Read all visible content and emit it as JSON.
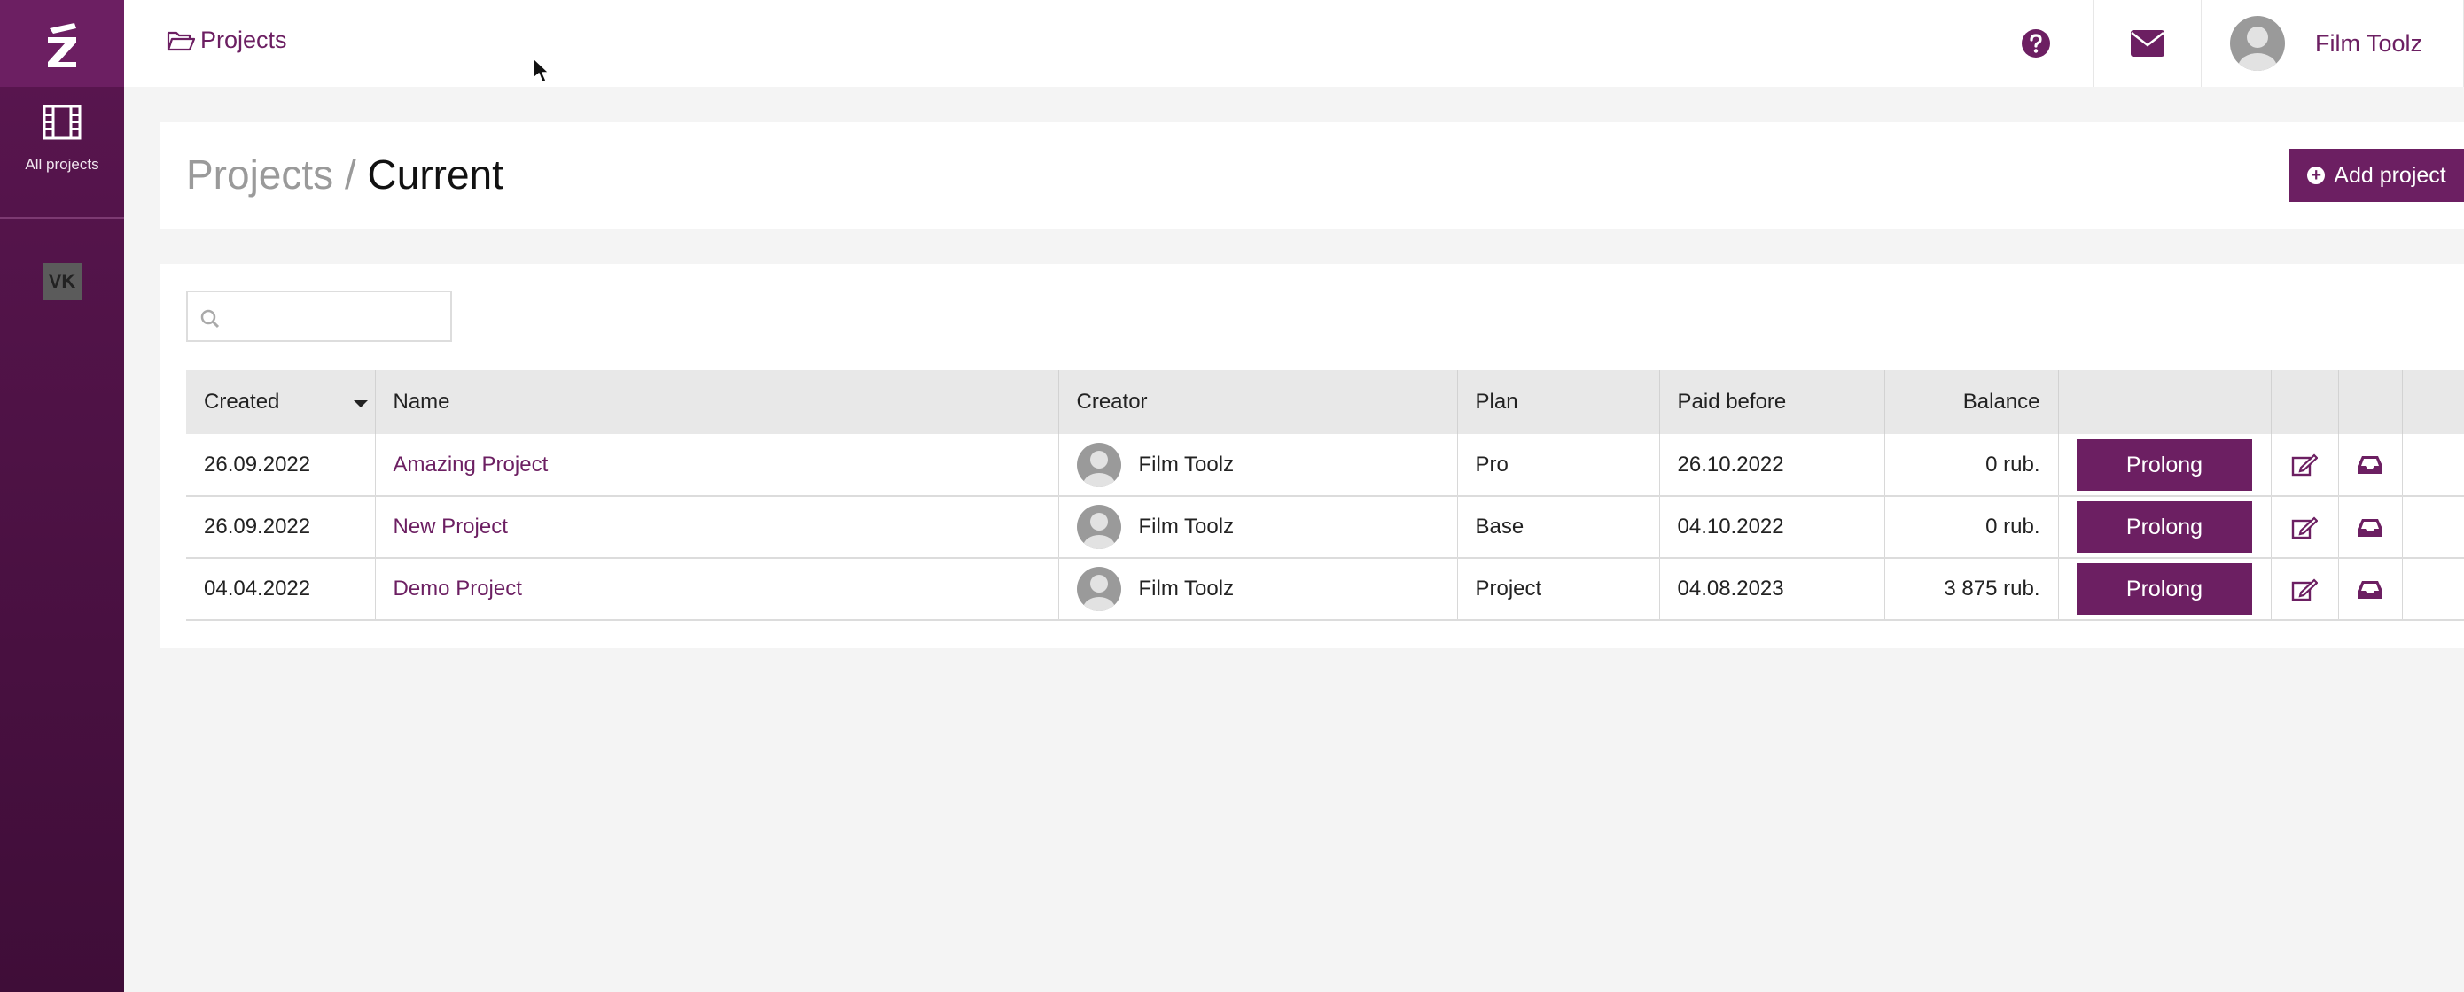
{
  "sidebar": {
    "logo_icon": "film-toolz-z-logo",
    "items": [
      {
        "label": "All projects",
        "icon": "film-icon"
      }
    ],
    "social_icon": "vk-icon",
    "social_label": "VK"
  },
  "topbar": {
    "breadcrumb": "Projects",
    "breadcrumb_icon": "folder-open-icon",
    "help_icon": "question-circle-icon",
    "mail_icon": "envelope-icon",
    "user_name": "Film Toolz"
  },
  "page": {
    "title_parent": "Projects /",
    "title_current": "Current",
    "add_button": "Add project"
  },
  "search": {
    "placeholder": ""
  },
  "table": {
    "headers": [
      "Created",
      "Name",
      "Creator",
      "Plan",
      "Paid before",
      "Balance",
      "",
      "",
      ""
    ],
    "rows": [
      {
        "created": "26.09.2022",
        "name": "Amazing Project",
        "creator": "Film Toolz",
        "plan": "Pro",
        "paid_before": "26.10.2022",
        "balance": "0 rub.",
        "action": "Prolong"
      },
      {
        "created": "26.09.2022",
        "name": "New Project",
        "creator": "Film Toolz",
        "plan": "Base",
        "paid_before": "04.10.2022",
        "balance": "0 rub.",
        "action": "Prolong"
      },
      {
        "created": "04.04.2022",
        "name": "Demo Project",
        "creator": "Film Toolz",
        "plan": "Project",
        "paid_before": "04.08.2023",
        "balance": "3 875 rub.",
        "action": "Prolong"
      }
    ]
  },
  "colors": {
    "accent": "#6c1f62",
    "sidebar": "#4a1242",
    "background": "#f4f4f4"
  }
}
